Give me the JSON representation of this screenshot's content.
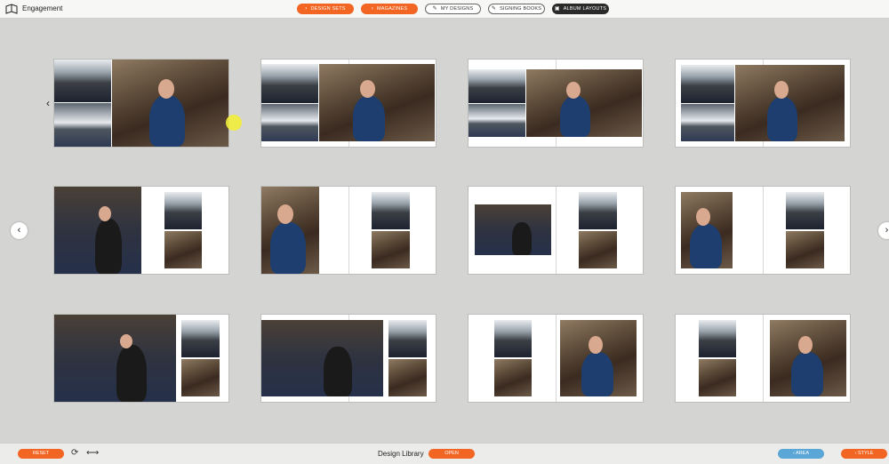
{
  "header": {
    "app_title": "Engagement",
    "tabs": [
      {
        "label": "DESIGN SETS",
        "icon": "chevron-right-icon",
        "style": "orange"
      },
      {
        "label": "MAGAZINES",
        "icon": "chevron-right-icon",
        "style": "orange"
      },
      {
        "label": "MY DESIGNS",
        "icon": "pencil-icon",
        "style": "outline"
      },
      {
        "label": "SIGNING BOOKS",
        "icon": "pencil-icon",
        "style": "outline"
      },
      {
        "label": "ALBUM LAYOUTS",
        "icon": "album-icon",
        "style": "dark"
      }
    ]
  },
  "workspace": {
    "prev_label": "‹",
    "next_label": "›",
    "layouts": [
      {
        "row": 1,
        "col": 1,
        "type": "left-strip-plus-large"
      },
      {
        "row": 1,
        "col": 2,
        "type": "left-strip-plus-large"
      },
      {
        "row": 1,
        "col": 3,
        "type": "left-strip-plus-large"
      },
      {
        "row": 1,
        "col": 4,
        "type": "left-strip-plus-large"
      },
      {
        "row": 2,
        "col": 1,
        "type": "large-left-two-right"
      },
      {
        "row": 2,
        "col": 2,
        "type": "large-left-two-right"
      },
      {
        "row": 2,
        "col": 3,
        "type": "medium-left-two-right"
      },
      {
        "row": 2,
        "col": 4,
        "type": "portrait-left-two-right"
      },
      {
        "row": 3,
        "col": 1,
        "type": "wide-left-two-right"
      },
      {
        "row": 3,
        "col": 2,
        "type": "wide-left-two-right"
      },
      {
        "row": 3,
        "col": 3,
        "type": "two-left-large-right"
      },
      {
        "row": 3,
        "col": 4,
        "type": "two-left-large-right"
      }
    ]
  },
  "footer": {
    "reset_label": "RESET",
    "library_title": "Design Library",
    "open_label": "OPEN",
    "area_label": "AREA",
    "style_label": "STYLE"
  },
  "colors": {
    "accent": "#f26522",
    "area": "#5aa6d6",
    "dark_tab": "#2a2a2a",
    "background": "#d4d4d2"
  }
}
